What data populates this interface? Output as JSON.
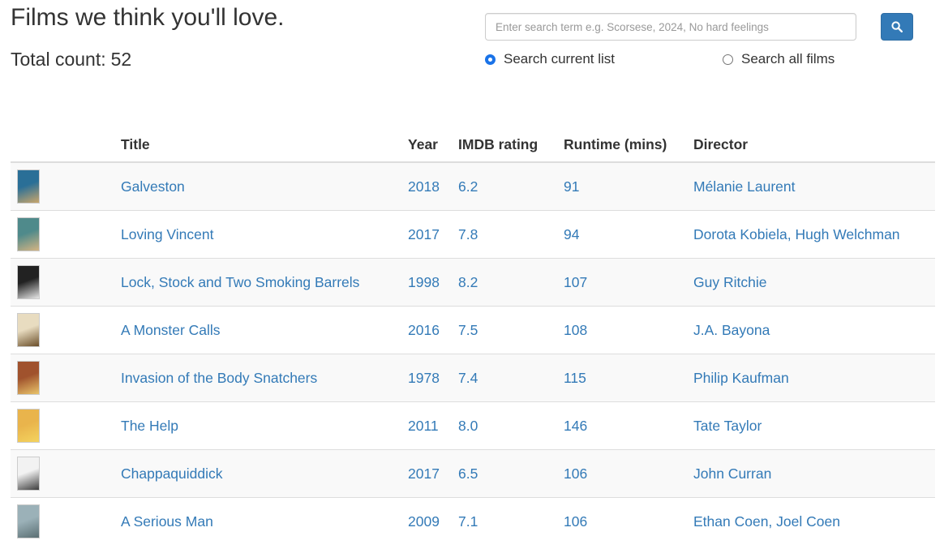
{
  "header": {
    "title": "Films we think you'll love.",
    "total_label": "Total count:",
    "total_count": "52"
  },
  "search": {
    "placeholder": "Enter search term e.g. Scorsese, 2024, No hard feelings",
    "value": "",
    "button_icon": "search-icon",
    "scope_options": [
      {
        "label": "Search current list",
        "selected": true
      },
      {
        "label": "Search all films",
        "selected": false
      }
    ]
  },
  "table": {
    "columns": [
      "",
      "Title",
      "Year",
      "IMDB rating",
      "Runtime (mins)",
      "Director"
    ],
    "rows": [
      {
        "title": "Galveston",
        "year": "2018",
        "rating": "6.2",
        "runtime": "91",
        "director": "Mélanie Laurent",
        "poster_colors": [
          "#2a6f97",
          "#c9a66b"
        ]
      },
      {
        "title": "Loving Vincent",
        "year": "2017",
        "rating": "7.8",
        "runtime": "94",
        "director": "Dorota Kobiela, Hugh Welchman",
        "poster_colors": [
          "#4f8a8b",
          "#d4b483"
        ]
      },
      {
        "title": "Lock, Stock and Two Smoking Barrels",
        "year": "1998",
        "rating": "8.2",
        "runtime": "107",
        "director": "Guy Ritchie",
        "poster_colors": [
          "#222222",
          "#e6e6e6"
        ]
      },
      {
        "title": "A Monster Calls",
        "year": "2016",
        "rating": "7.5",
        "runtime": "108",
        "director": "J.A. Bayona",
        "poster_colors": [
          "#e8dcc0",
          "#6b4f2a"
        ]
      },
      {
        "title": "Invasion of the Body Snatchers",
        "year": "1978",
        "rating": "7.4",
        "runtime": "115",
        "director": "Philip Kaufman",
        "poster_colors": [
          "#a0522d",
          "#e9c46a"
        ]
      },
      {
        "title": "The Help",
        "year": "2011",
        "rating": "8.0",
        "runtime": "146",
        "director": "Tate Taylor",
        "poster_colors": [
          "#e9b44c",
          "#f4d35e"
        ]
      },
      {
        "title": "Chappaquiddick",
        "year": "2017",
        "rating": "6.5",
        "runtime": "106",
        "director": "John Curran",
        "poster_colors": [
          "#f2f2f2",
          "#3d3d3d"
        ]
      },
      {
        "title": "A Serious Man",
        "year": "2009",
        "rating": "7.1",
        "runtime": "106",
        "director": "Ethan Coen, Joel Coen",
        "poster_colors": [
          "#9bb1b8",
          "#5b6f73"
        ]
      }
    ]
  },
  "colors": {
    "link": "#337ab7",
    "primary_button": "#337ab7",
    "radio_selected": "#1a73e8",
    "row_stripe": "#f9f9f9"
  }
}
